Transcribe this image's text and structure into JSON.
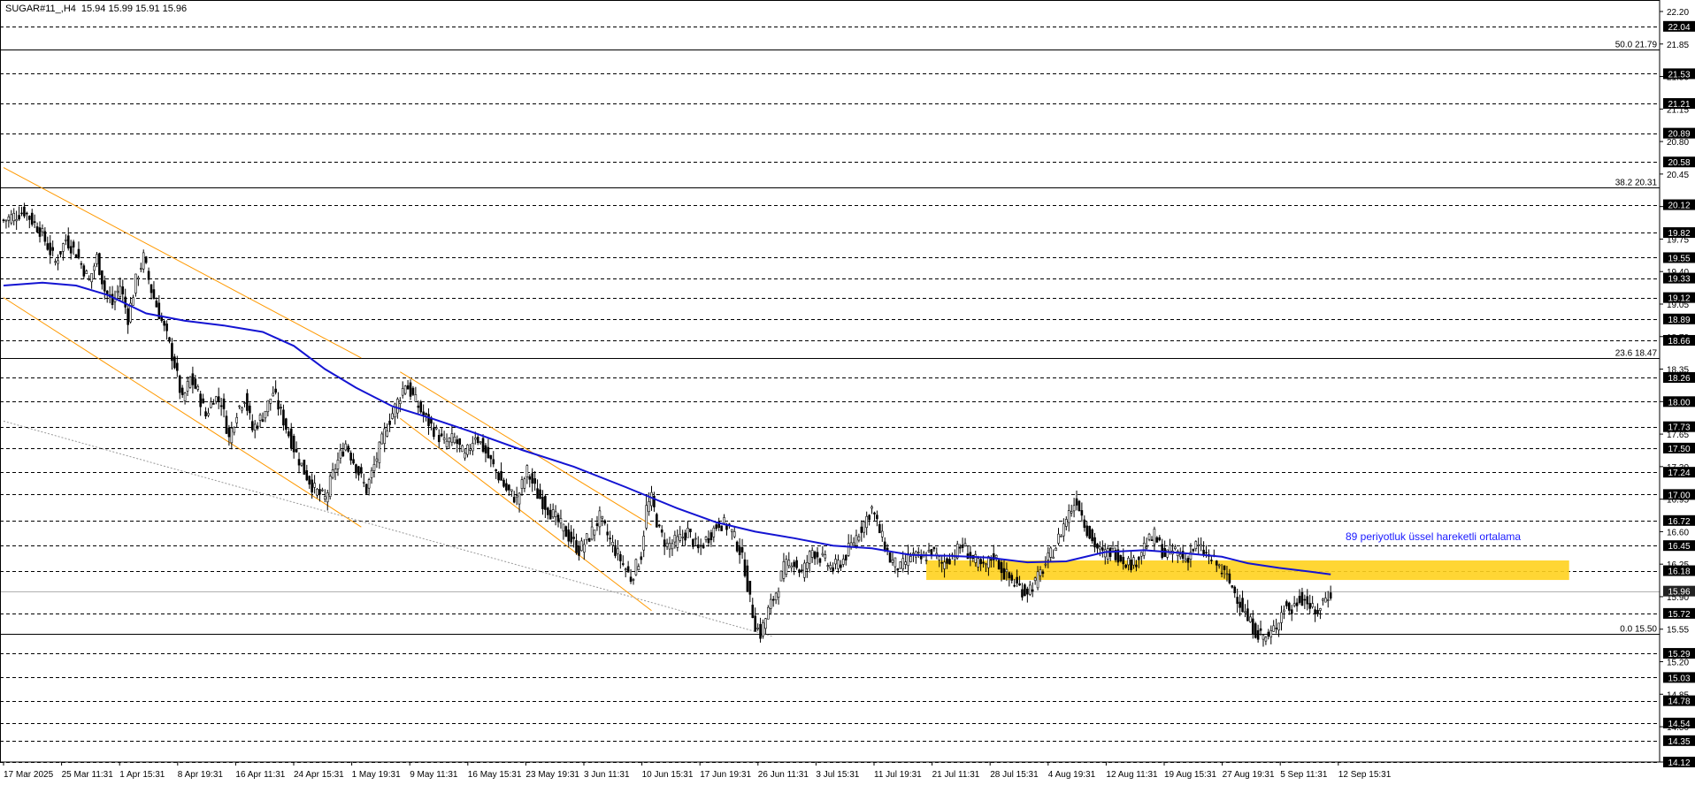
{
  "header": {
    "symbol": "SUGAR#11_,H4",
    "ohlc": "15.94 15.99 15.91 15.96"
  },
  "colors": {
    "background": "#ffffff",
    "grid_level": "#000000",
    "candle": "#000000",
    "ema": "#1414d2",
    "channel": "#ff9900",
    "trend_dotted": "#999999",
    "zone": "#ffd21e",
    "tag_bg": "#000000",
    "annotation": "#1a1aff"
  },
  "annotation": {
    "ema_label": "89 periyotluk üssel hareketli ortalama"
  },
  "chart_data": {
    "type": "candlestick",
    "title": "SUGAR#11_,H4",
    "ylim": [
      14.12,
      22.2
    ],
    "x_ticks": [
      "17 Mar 2025",
      "25 Mar 11:31",
      "1 Apr 15:31",
      "8 Apr 19:31",
      "16 Apr 11:31",
      "24 Apr 15:31",
      "1 May 19:31",
      "9 May 11:31",
      "16 May 15:31",
      "23 May 19:31",
      "3 Jun 11:31",
      "10 Jun 15:31",
      "17 Jun 19:31",
      "26 Jun 11:31",
      "3 Jul 15:31",
      "11 Jul 19:31",
      "21 Jul 11:31",
      "28 Jul 15:31",
      "4 Aug 19:31",
      "12 Aug 11:31",
      "19 Aug 15:31",
      "27 Aug 19:31",
      "5 Sep 11:31",
      "12 Sep 15:31"
    ],
    "y_ticks": [
      "22.20",
      "21.85",
      "21.50",
      "21.15",
      "20.80",
      "20.45",
      "20.10",
      "19.75",
      "19.40",
      "19.05",
      "18.70",
      "18.35",
      "18.00",
      "17.65",
      "17.30",
      "16.95",
      "16.60",
      "16.25",
      "15.90",
      "15.55",
      "15.20",
      "14.85",
      "14.50",
      "14.12"
    ],
    "horizontal_levels": [
      "22.04",
      "21.53",
      "21.21",
      "20.89",
      "20.58",
      "20.12",
      "19.82",
      "19.55",
      "19.33",
      "19.12",
      "18.89",
      "18.66",
      "18.26",
      "18.00",
      "17.73",
      "17.50",
      "17.24",
      "17.00",
      "16.72",
      "16.45",
      "16.18",
      "15.96",
      "15.72",
      "15.29",
      "15.03",
      "14.78",
      "14.54",
      "14.35",
      "14.12"
    ],
    "fibonacci": [
      {
        "label": "50.0 21.79",
        "value": 21.79
      },
      {
        "label": "38.2 20.31",
        "value": 20.31
      },
      {
        "label": "23.6 18.47",
        "value": 18.47
      },
      {
        "label": "0.0 15.50",
        "value": 15.5
      }
    ],
    "current_price": 15.96,
    "resistance_zone": {
      "low": 16.08,
      "high": 16.29
    },
    "price_path": [
      [
        0,
        19.95
      ],
      [
        8,
        20.05
      ],
      [
        14,
        19.85
      ],
      [
        20,
        19.5
      ],
      [
        24,
        19.75
      ],
      [
        28,
        19.6
      ],
      [
        33,
        19.3
      ],
      [
        36,
        19.55
      ],
      [
        39,
        19.2
      ],
      [
        42,
        19.05
      ],
      [
        45,
        19.25
      ],
      [
        48,
        18.9
      ],
      [
        51,
        19.3
      ],
      [
        54,
        19.55
      ],
      [
        57,
        19.2
      ],
      [
        60,
        18.95
      ],
      [
        63,
        18.7
      ],
      [
        66,
        18.4
      ],
      [
        69,
        18.0
      ],
      [
        72,
        18.25
      ],
      [
        75,
        18.1
      ],
      [
        78,
        17.85
      ],
      [
        81,
        18.05
      ],
      [
        84,
        18.0
      ],
      [
        87,
        17.6
      ],
      [
        90,
        17.9
      ],
      [
        93,
        18.05
      ],
      [
        96,
        17.7
      ],
      [
        100,
        17.85
      ],
      [
        104,
        18.1
      ],
      [
        108,
        17.8
      ],
      [
        112,
        17.5
      ],
      [
        116,
        17.25
      ],
      [
        120,
        17.05
      ],
      [
        124,
        16.95
      ],
      [
        128,
        17.3
      ],
      [
        132,
        17.55
      ],
      [
        136,
        17.3
      ],
      [
        140,
        17.05
      ],
      [
        144,
        17.4
      ],
      [
        148,
        17.75
      ],
      [
        152,
        18.0
      ],
      [
        155,
        18.2
      ],
      [
        158,
        18.05
      ],
      [
        162,
        17.85
      ],
      [
        166,
        17.7
      ],
      [
        170,
        17.55
      ],
      [
        174,
        17.6
      ],
      [
        178,
        17.4
      ],
      [
        182,
        17.65
      ],
      [
        186,
        17.45
      ],
      [
        190,
        17.25
      ],
      [
        194,
        17.05
      ],
      [
        198,
        16.95
      ],
      [
        202,
        17.25
      ],
      [
        206,
        17.0
      ],
      [
        210,
        16.85
      ],
      [
        214,
        16.7
      ],
      [
        218,
        16.55
      ],
      [
        222,
        16.4
      ],
      [
        226,
        16.55
      ],
      [
        230,
        16.75
      ],
      [
        234,
        16.5
      ],
      [
        238,
        16.3
      ],
      [
        242,
        16.1
      ],
      [
        246,
        16.35
      ],
      [
        248,
        16.85
      ],
      [
        250,
        16.95
      ],
      [
        253,
        16.6
      ],
      [
        256,
        16.45
      ],
      [
        260,
        16.5
      ],
      [
        264,
        16.6
      ],
      [
        268,
        16.4
      ],
      [
        272,
        16.55
      ],
      [
        276,
        16.7
      ],
      [
        280,
        16.65
      ],
      [
        284,
        16.4
      ],
      [
        286,
        16.2
      ],
      [
        288,
        15.85
      ],
      [
        290,
        15.6
      ],
      [
        292,
        15.5
      ],
      [
        295,
        15.75
      ],
      [
        298,
        15.95
      ],
      [
        301,
        16.2
      ],
      [
        304,
        16.3
      ],
      [
        308,
        16.15
      ],
      [
        312,
        16.4
      ],
      [
        316,
        16.3
      ],
      [
        320,
        16.2
      ],
      [
        324,
        16.3
      ],
      [
        328,
        16.5
      ],
      [
        332,
        16.7
      ],
      [
        335,
        16.85
      ],
      [
        338,
        16.6
      ],
      [
        342,
        16.3
      ],
      [
        346,
        16.2
      ],
      [
        350,
        16.35
      ],
      [
        354,
        16.3
      ],
      [
        358,
        16.4
      ],
      [
        362,
        16.25
      ],
      [
        366,
        16.35
      ],
      [
        370,
        16.45
      ],
      [
        374,
        16.3
      ],
      [
        378,
        16.2
      ],
      [
        382,
        16.35
      ],
      [
        386,
        16.15
      ],
      [
        390,
        16.05
      ],
      [
        394,
        15.95
      ],
      [
        398,
        16.05
      ],
      [
        402,
        16.25
      ],
      [
        406,
        16.45
      ],
      [
        410,
        16.75
      ],
      [
        414,
        16.95
      ],
      [
        417,
        16.7
      ],
      [
        420,
        16.5
      ],
      [
        424,
        16.35
      ],
      [
        428,
        16.4
      ],
      [
        432,
        16.3
      ],
      [
        436,
        16.25
      ],
      [
        440,
        16.45
      ],
      [
        444,
        16.55
      ],
      [
        448,
        16.35
      ],
      [
        452,
        16.4
      ],
      [
        456,
        16.3
      ],
      [
        460,
        16.45
      ],
      [
        464,
        16.35
      ],
      [
        468,
        16.25
      ],
      [
        472,
        16.1
      ],
      [
        476,
        15.9
      ],
      [
        480,
        15.65
      ],
      [
        484,
        15.5
      ],
      [
        488,
        15.45
      ],
      [
        491,
        15.6
      ],
      [
        494,
        15.8
      ],
      [
        497,
        15.75
      ],
      [
        500,
        15.9
      ],
      [
        503,
        15.85
      ],
      [
        506,
        15.7
      ],
      [
        509,
        15.85
      ],
      [
        512,
        15.95
      ]
    ],
    "ema_path": [
      [
        0,
        19.25
      ],
      [
        15,
        19.28
      ],
      [
        28,
        19.25
      ],
      [
        40,
        19.15
      ],
      [
        55,
        18.95
      ],
      [
        70,
        18.87
      ],
      [
        85,
        18.82
      ],
      [
        100,
        18.75
      ],
      [
        112,
        18.6
      ],
      [
        124,
        18.35
      ],
      [
        136,
        18.15
      ],
      [
        150,
        17.95
      ],
      [
        165,
        17.82
      ],
      [
        180,
        17.68
      ],
      [
        200,
        17.48
      ],
      [
        220,
        17.3
      ],
      [
        240,
        17.08
      ],
      [
        260,
        16.85
      ],
      [
        275,
        16.7
      ],
      [
        290,
        16.6
      ],
      [
        305,
        16.53
      ],
      [
        320,
        16.45
      ],
      [
        335,
        16.42
      ],
      [
        350,
        16.35
      ],
      [
        365,
        16.34
      ],
      [
        380,
        16.32
      ],
      [
        395,
        16.27
      ],
      [
        410,
        16.28
      ],
      [
        425,
        16.38
      ],
      [
        440,
        16.4
      ],
      [
        455,
        16.37
      ],
      [
        470,
        16.33
      ],
      [
        480,
        16.26
      ],
      [
        492,
        16.21
      ],
      [
        504,
        16.17
      ],
      [
        512,
        16.14
      ]
    ],
    "channels": [
      {
        "start": [
          0,
          20.52
        ],
        "end": [
          138,
          18.47
        ]
      },
      {
        "start": [
          0,
          19.12
        ],
        "end": [
          138,
          16.65
        ]
      },
      {
        "start": [
          153,
          18.32
        ],
        "end": [
          250,
          16.67
        ]
      },
      {
        "start": [
          153,
          17.82
        ],
        "end": [
          250,
          15.75
        ]
      }
    ],
    "trend_dotted": {
      "start": [
        0,
        17.79
      ],
      "end": [
        297,
        15.47
      ]
    }
  }
}
